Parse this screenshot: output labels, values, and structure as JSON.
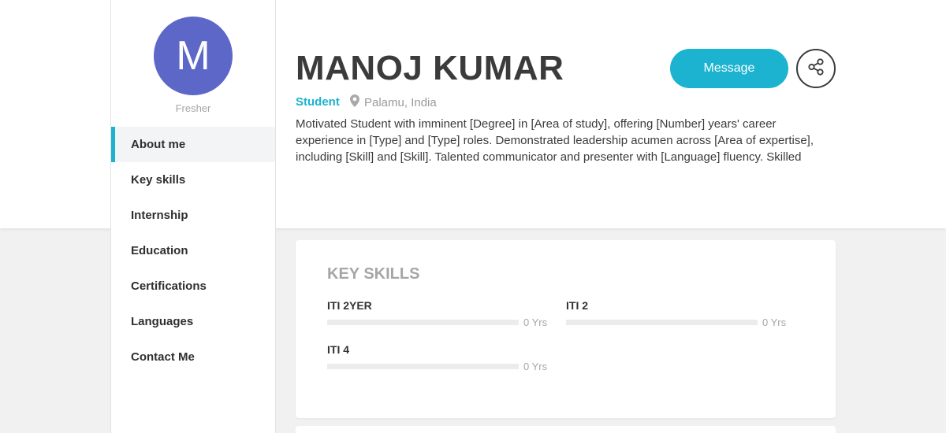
{
  "profile": {
    "avatar_letter": "M",
    "status": "Fresher",
    "name": "MANOJ KUMAR",
    "role": "Student",
    "location": "Palamu, India",
    "summary": "Motivated Student with imminent [Degree] in [Area of study], offering [Number] years' career experience in [Type] and [Type] roles. Demonstrated leadership acumen across [Area of expertise], including [Skill] and [Skill]. Talented communicator and presenter with [Language] fluency. Skilled"
  },
  "actions": {
    "message_label": "Message"
  },
  "sidebar": {
    "items": [
      {
        "label": "About me",
        "active": true
      },
      {
        "label": "Key skills"
      },
      {
        "label": "Internship"
      },
      {
        "label": "Education"
      },
      {
        "label": "Certifications"
      },
      {
        "label": "Languages"
      },
      {
        "label": "Contact Me"
      }
    ]
  },
  "key_skills": {
    "title": "KEY SKILLS",
    "skills": [
      {
        "name": "ITI 2YER",
        "years": "0 Yrs",
        "level": 0
      },
      {
        "name": "ITI 2",
        "years": "0 Yrs",
        "level": 0
      },
      {
        "name": "ITI 4",
        "years": "0 Yrs",
        "level": 0
      }
    ]
  },
  "colors": {
    "accent": "#1bb3cf",
    "avatar": "#5c67c7",
    "background": "#f1f1f2"
  },
  "icons": {
    "location": "map-pin-icon",
    "share": "share-icon"
  }
}
